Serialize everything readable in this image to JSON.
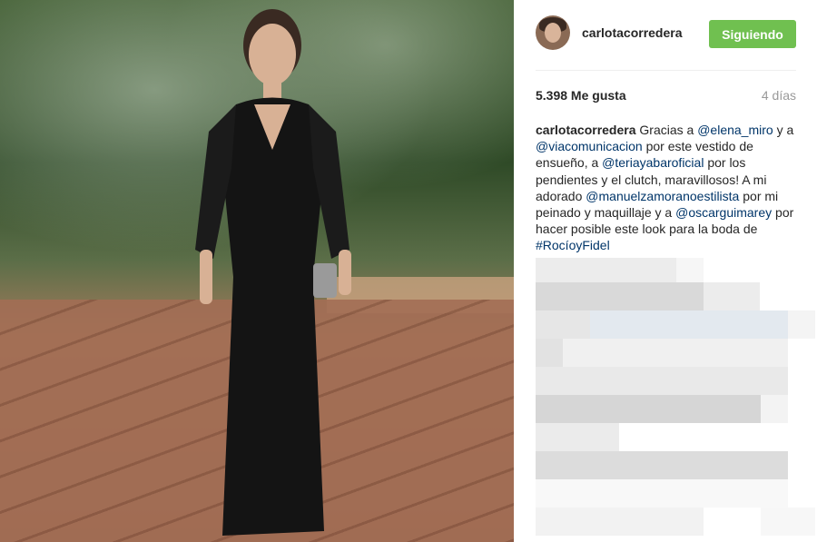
{
  "post": {
    "username": "carlotacorredera",
    "follow_label": "Siguiendo",
    "likes": "5.398 Me gusta",
    "time_ago": "4 días",
    "caption": [
      {
        "type": "user",
        "text": "carlotacorredera"
      },
      {
        "type": "text",
        "text": " Gracias a "
      },
      {
        "type": "mention",
        "text": "@elena_miro"
      },
      {
        "type": "text",
        "text": " y a "
      },
      {
        "type": "mention",
        "text": "@viacomunicacion"
      },
      {
        "type": "text",
        "text": " por este vestido de ensueño, a "
      },
      {
        "type": "mention",
        "text": "@teriayabaroficial"
      },
      {
        "type": "text",
        "text": " por los pendientes y el clutch, maravillosos! A mi adorado "
      },
      {
        "type": "mention",
        "text": "@manuelzamoranoestilista"
      },
      {
        "type": "text",
        "text": " por mi peinado y maquillaje y a "
      },
      {
        "type": "mention",
        "text": "@oscarguimarey"
      },
      {
        "type": "text",
        "text": " por hacer posible este look para la boda de "
      },
      {
        "type": "mention",
        "text": "#RocíoyFidel"
      }
    ]
  },
  "colors": {
    "follow_button": "#70c050",
    "mention": "#003569",
    "muted": "#999999"
  },
  "icons": {
    "avatar": "profile-photo"
  }
}
